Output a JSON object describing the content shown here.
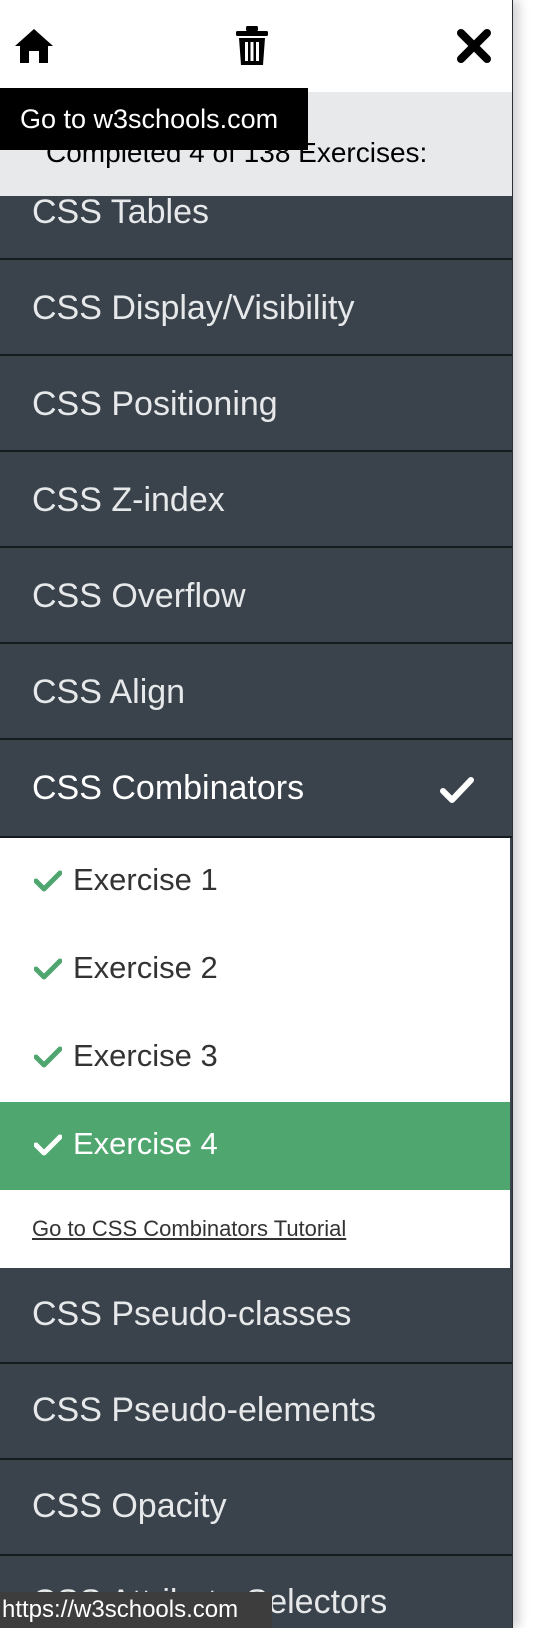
{
  "topbar": {
    "home_icon": "home-icon",
    "trash_icon": "trash-icon",
    "close_icon": "close-icon"
  },
  "tooltip": "Go to w3schools.com",
  "progress_text": "Completed 4 of 138 Exercises:",
  "menu": {
    "items": [
      {
        "label": "CSS Tables"
      },
      {
        "label": "CSS Display/Visibility"
      },
      {
        "label": "CSS Positioning"
      },
      {
        "label": "CSS Z-index"
      },
      {
        "label": "CSS Overflow"
      },
      {
        "label": "CSS Align"
      },
      {
        "label": "CSS Combinators"
      },
      {
        "label": "CSS Pseudo-classes"
      },
      {
        "label": "CSS Pseudo-elements"
      },
      {
        "label": "CSS Opacity"
      },
      {
        "label": "CSS Attribute Selectors"
      }
    ],
    "expanded": {
      "exercises": [
        "Exercise 1",
        "Exercise 2",
        "Exercise 3",
        "Exercise 4"
      ],
      "current_exercise": "Exercise 4",
      "tutorial_link": "Go to CSS Combinators Tutorial"
    }
  },
  "colors": {
    "panel": "#3a434c",
    "accent_green": "#4fa76f",
    "progress_bg": "#e7e9eb"
  },
  "status_url": "https://w3schools.com"
}
